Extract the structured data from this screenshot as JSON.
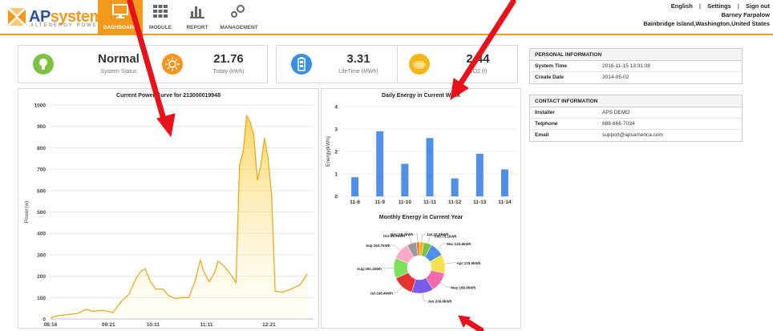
{
  "header": {
    "logo": {
      "ap": "AP",
      "systems": "systems",
      "tagline": "ALTENERGY POWER"
    },
    "nav": [
      {
        "label": "DASHBOARD"
      },
      {
        "label": "MODULE"
      },
      {
        "label": "REPORT"
      },
      {
        "label": "MANAGEMENT"
      }
    ],
    "links": {
      "english": "English",
      "settings": "Settings",
      "signout": "Sign out"
    },
    "user_name": "Barney Farpalow",
    "user_location": "Bainbridge Island,Washington,United States"
  },
  "stats": [
    {
      "value": "Normal",
      "caption": "System Status",
      "color": "#7dc242"
    },
    {
      "value": "21.76",
      "caption": "Today (kWh)",
      "color": "#f7941d"
    },
    {
      "value": "3.31",
      "caption": "LifeTime (MWh)",
      "color": "#3b8fe0"
    },
    {
      "value": "2.44",
      "caption": "CO2 (t)",
      "color": "#f6b51a"
    }
  ],
  "personal": {
    "title": "PERSONAL INFORMATION",
    "rows": [
      {
        "key": "System Time",
        "value": "2016-11-15 13:01:08"
      },
      {
        "key": "Create Date",
        "value": "2014-05-02"
      }
    ]
  },
  "contact": {
    "title": "CONTACT INFORMATION",
    "rows": [
      {
        "key": "Installer",
        "value": "APS DEMO"
      },
      {
        "key": "Telphone",
        "value": "888-666-7034"
      },
      {
        "key": "Email",
        "value": "support@apsamerica.com"
      }
    ]
  },
  "chart_data": [
    {
      "type": "area",
      "title": "Current Power Curve for 213000019948",
      "ylabel": "Power(w)",
      "xlabel": "",
      "ylim": [
        0,
        1000
      ],
      "yticks": [
        0,
        100,
        200,
        300,
        400,
        500,
        600,
        700,
        800,
        900,
        1000
      ],
      "xticks": [
        {
          "label": "08:16",
          "t": 0
        },
        {
          "label": "09:21",
          "t": 65
        },
        {
          "label": "10:11",
          "t": 115
        },
        {
          "label": "11:11",
          "t": 175
        },
        {
          "label": "12:21",
          "t": 245
        }
      ],
      "points": [
        [
          0,
          5
        ],
        [
          8,
          15
        ],
        [
          18,
          20
        ],
        [
          30,
          25
        ],
        [
          40,
          45
        ],
        [
          48,
          35
        ],
        [
          55,
          40
        ],
        [
          62,
          38
        ],
        [
          70,
          30
        ],
        [
          80,
          85
        ],
        [
          88,
          115
        ],
        [
          96,
          190
        ],
        [
          102,
          225
        ],
        [
          106,
          235
        ],
        [
          112,
          175
        ],
        [
          118,
          140
        ],
        [
          126,
          140
        ],
        [
          132,
          110
        ],
        [
          140,
          95
        ],
        [
          148,
          100
        ],
        [
          155,
          100
        ],
        [
          162,
          175
        ],
        [
          168,
          275
        ],
        [
          172,
          220
        ],
        [
          178,
          175
        ],
        [
          184,
          215
        ],
        [
          188,
          270
        ],
        [
          194,
          250
        ],
        [
          200,
          220
        ],
        [
          205,
          190
        ],
        [
          208,
          170
        ],
        [
          212,
          720
        ],
        [
          216,
          780
        ],
        [
          220,
          950
        ],
        [
          224,
          920
        ],
        [
          228,
          860
        ],
        [
          232,
          650
        ],
        [
          236,
          720
        ],
        [
          240,
          845
        ],
        [
          244,
          750
        ],
        [
          248,
          580
        ],
        [
          252,
          130
        ],
        [
          260,
          125
        ],
        [
          270,
          140
        ],
        [
          280,
          160
        ],
        [
          288,
          210
        ]
      ],
      "tmax": 295
    },
    {
      "type": "bar",
      "title": "Daily Energy in Current Week",
      "categories": [
        "11-8",
        "11-9",
        "11-10",
        "11-11",
        "11-12",
        "11-13",
        "11-14"
      ],
      "values": [
        0.85,
        2.9,
        1.45,
        2.6,
        0.8,
        1.9,
        1.2
      ],
      "ylabel": "Energy(kWh)",
      "ylim": [
        0,
        4
      ],
      "yticks": [
        0,
        1,
        2,
        3,
        4
      ],
      "color": "#4f8fe8"
    },
    {
      "type": "pie",
      "title": "Monthly Energy in Current Year",
      "donut": true,
      "slices": [
        {
          "label": "Jan:41.8kWh",
          "value": 41.8,
          "color": "#f0b514"
        },
        {
          "label": "Feb:75.1kWh",
          "value": 75.1,
          "color": "#7cc243"
        },
        {
          "label": "Mar:132.6kWh",
          "value": 132.6,
          "color": "#4f8fe8"
        },
        {
          "label": "Apr:176.9kWh",
          "value": 176.9,
          "color": "#f5e14d"
        },
        {
          "label": "May:186.6kWh",
          "value": 186.6,
          "color": "#f46aa8"
        },
        {
          "label": "Jun:206.8kWh",
          "value": 206.8,
          "color": "#7a5ce8"
        },
        {
          "label": "Jul:198.4kWh",
          "value": 198.4,
          "color": "#e8322f"
        },
        {
          "label": "Aug:192.1kWh",
          "value": 192.1,
          "color": "#7ee05a"
        },
        {
          "label": "Sep:163.7kWh",
          "value": 163.7,
          "color": "#f9a8c8"
        },
        {
          "label": "Oct:88.9kWh",
          "value": 88.9,
          "color": "#9a9a9a"
        },
        {
          "label": "Nov:29.3kWh",
          "value": 29.3,
          "color": "#e87a2a"
        }
      ]
    }
  ]
}
